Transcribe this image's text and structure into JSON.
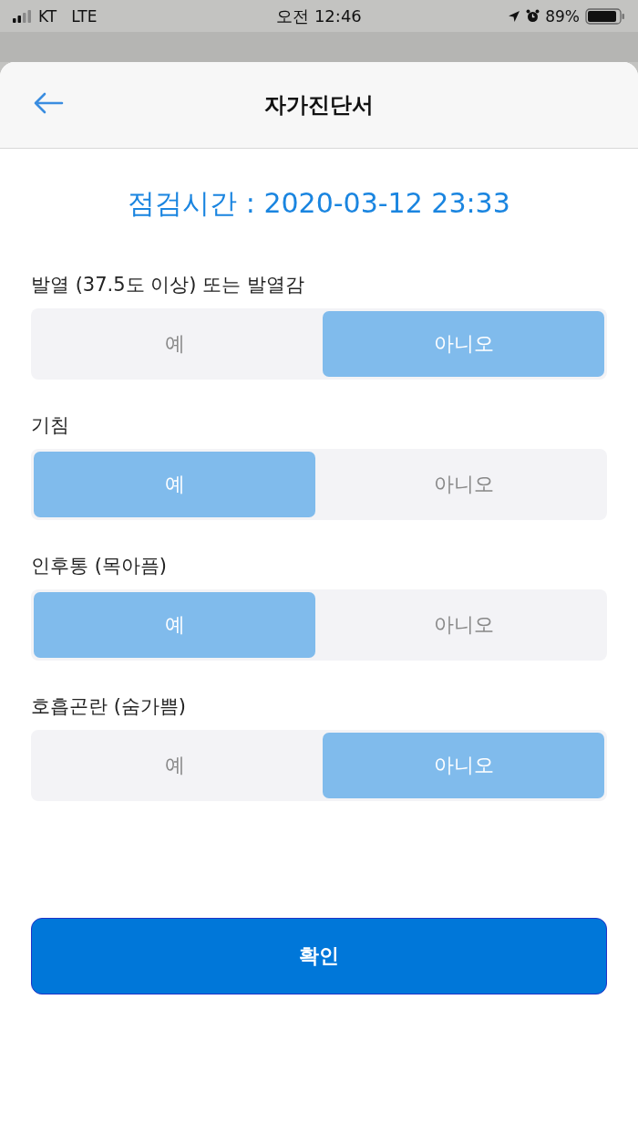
{
  "status_bar": {
    "carrier": "KT",
    "network": "LTE",
    "time": "오전 12:46",
    "battery": "89%"
  },
  "header": {
    "title": "자가진단서"
  },
  "check_time": "점검시간 : 2020-03-12 23:33",
  "questions": [
    {
      "label": "발열 (37.5도 이상) 또는 발열감",
      "options": [
        {
          "label": "예",
          "selected": false
        },
        {
          "label": "아니오",
          "selected": true
        }
      ]
    },
    {
      "label": "기침",
      "options": [
        {
          "label": "예",
          "selected": true
        },
        {
          "label": "아니오",
          "selected": false
        }
      ]
    },
    {
      "label": "인후통 (목아픔)",
      "options": [
        {
          "label": "예",
          "selected": true
        },
        {
          "label": "아니오",
          "selected": false
        }
      ]
    },
    {
      "label": "호흡곤란 (숨가쁨)",
      "options": [
        {
          "label": "예",
          "selected": false
        },
        {
          "label": "아니오",
          "selected": true
        }
      ]
    }
  ],
  "confirm_button": "확인"
}
